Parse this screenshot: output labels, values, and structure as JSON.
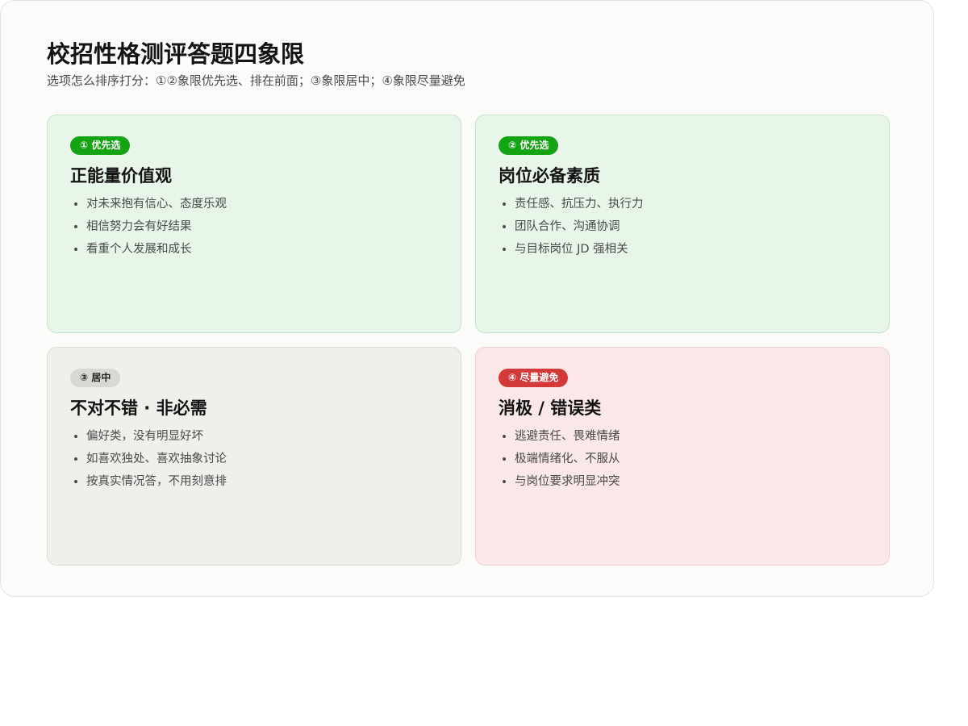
{
  "header": {
    "title": "校招性格测评答题四象限",
    "subtitle": "选项怎么排序打分：①②象限优先选、排在前面；③象限居中；④象限尽量避免"
  },
  "quadrants": [
    {
      "badge": "① 优先选",
      "title": "正能量价值观",
      "tone": "green",
      "items": [
        "对未来抱有信心、态度乐观",
        "相信努力会有好结果",
        "看重个人发展和成长"
      ]
    },
    {
      "badge": "② 优先选",
      "title": "岗位必备素质",
      "tone": "green",
      "items": [
        "责任感、抗压力、执行力",
        "团队合作、沟通协调",
        "与目标岗位 JD 强相关"
      ]
    },
    {
      "badge": "③ 居中",
      "title": "不对不错 · 非必需",
      "tone": "grey",
      "items": [
        "偏好类，没有明显好坏",
        "如喜欢独处、喜欢抽象讨论",
        "按真实情况答，不用刻意排"
      ]
    },
    {
      "badge": "④ 尽量避免",
      "title": "消极 / 错误类",
      "tone": "red",
      "items": [
        "逃避责任、畏难情绪",
        "极端情绪化、不服从",
        "与岗位要求明显冲突"
      ]
    }
  ],
  "colors": {
    "green_badge": "#13a313",
    "green_card": "#e8f5e9",
    "grey_badge": "#d9d8d2",
    "grey_card": "#f0efec",
    "red_badge": "#d23a3a",
    "red_card": "#fae8e8"
  }
}
